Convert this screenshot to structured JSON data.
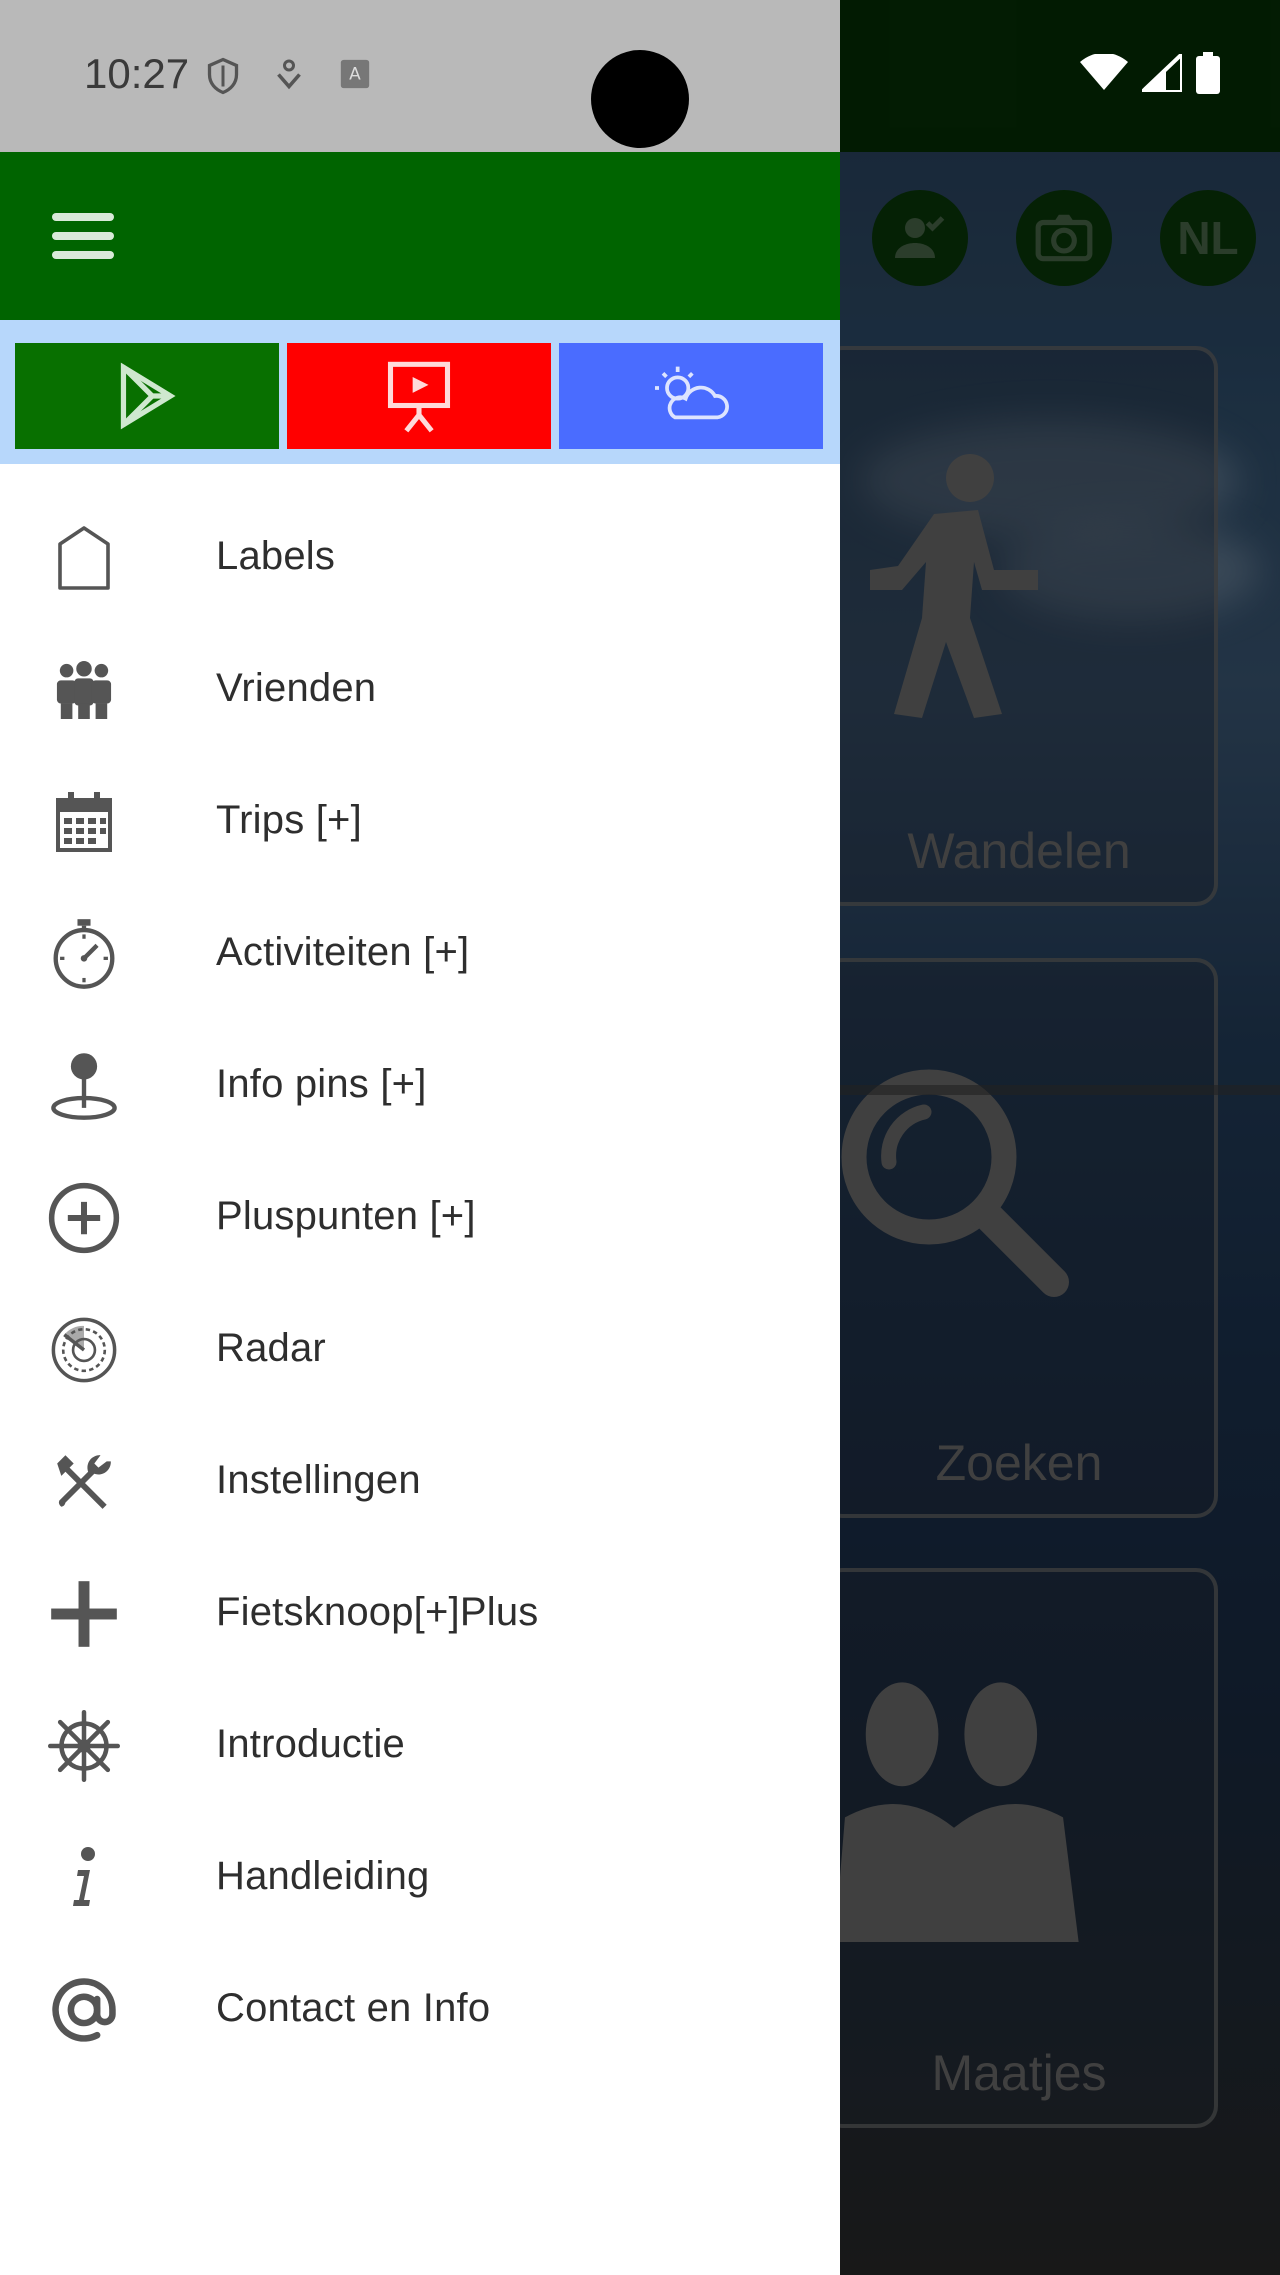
{
  "status_bar": {
    "time": "10:27"
  },
  "background_app": {
    "language_badge": "NL",
    "tiles": [
      {
        "label": "Wandelen"
      },
      {
        "label": "Zoeken"
      },
      {
        "label": "Maatjes"
      }
    ]
  },
  "drawer": {
    "quick_buttons": [
      {
        "icon": "play-store-icon",
        "color": "#087000"
      },
      {
        "icon": "presentation-icon",
        "color": "#ff0000"
      },
      {
        "icon": "weather-icon",
        "color": "#4a6cff"
      }
    ],
    "menu_items": [
      {
        "label": "Labels",
        "icon": "tag-icon"
      },
      {
        "label": "Vrienden",
        "icon": "group-icon"
      },
      {
        "label": "Trips [+]",
        "icon": "calendar-icon"
      },
      {
        "label": "Activiteiten [+]",
        "icon": "stopwatch-icon"
      },
      {
        "label": "Info pins [+]",
        "icon": "pin-icon"
      },
      {
        "label": "Pluspunten [+]",
        "icon": "plus-circle-icon"
      },
      {
        "label": "Radar",
        "icon": "radar-icon"
      },
      {
        "label": "Instellingen",
        "icon": "tools-icon"
      },
      {
        "label": "Fietsknoop[+]Plus",
        "icon": "plus-icon"
      },
      {
        "label": "Introductie",
        "icon": "ship-wheel-icon"
      },
      {
        "label": "Handleiding",
        "icon": "info-icon"
      },
      {
        "label": "Contact en Info",
        "icon": "at-icon"
      }
    ]
  },
  "colors": {
    "header_green": "#006400",
    "strip_blue": "#b7d7fb",
    "icon_gray": "#555555",
    "label_text": "#2e2e2e"
  }
}
